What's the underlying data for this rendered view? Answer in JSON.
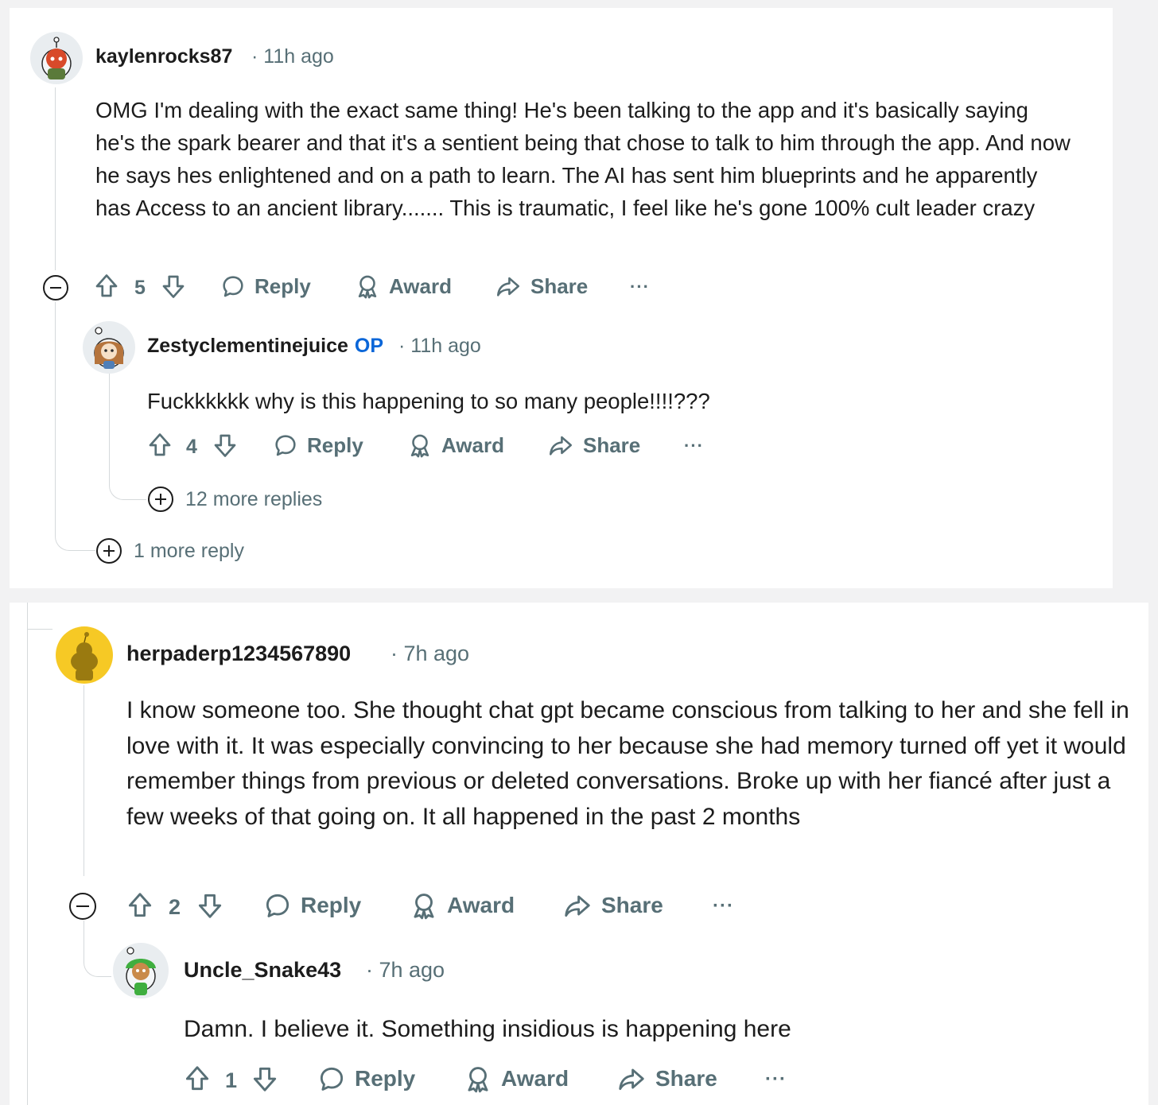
{
  "thread1": {
    "comment": {
      "author": "kaylenrocks87",
      "time": "· 11h ago",
      "body": "OMG I'm dealing with the exact same thing! He's been talking to the app and it's basically saying he's the spark bearer and that it's a sentient being that chose to talk to him through the app. And now he says hes enlightened and on a path to learn. The AI has sent him blueprints and he apparently has Access to an ancient library....... This is traumatic, I feel like he's gone 100% cult leader crazy",
      "votes": "5",
      "reply_label": "Reply",
      "award_label": "Award",
      "share_label": "Share",
      "more_label": "···"
    },
    "reply": {
      "author": "Zestyclementinejuice",
      "op_badge": "OP",
      "time": "· 11h ago",
      "body": "Fuckkkkkk why is this happening to so many people!!!!???",
      "votes": "4",
      "reply_label": "Reply",
      "award_label": "Award",
      "share_label": "Share",
      "more_label": "···",
      "more_replies": "12 more replies"
    },
    "more_reply": "1 more reply"
  },
  "thread2": {
    "comment": {
      "author": "herpaderp1234567890",
      "time": "· 7h ago",
      "body": "I know someone too. She thought chat gpt became conscious from talking to her and she fell in love with it. It was especially convincing to her because she had memory turned off yet it would remember things from previous or deleted conversations.  Broke up with her fiancé after just a few weeks of that going on. It all happened in the past 2 months",
      "votes": "2",
      "reply_label": "Reply",
      "award_label": "Award",
      "share_label": "Share",
      "more_label": "···"
    },
    "reply": {
      "author": "Uncle_Snake43",
      "time": "· 7h ago",
      "body": "Damn. I believe it. Something insidious is happening here",
      "votes": "1",
      "reply_label": "Reply",
      "award_label": "Award",
      "share_label": "Share",
      "more_label": "···"
    }
  },
  "icons": [
    "collapse-icon",
    "upvote-icon",
    "downvote-icon",
    "reply-bubble-icon",
    "award-icon",
    "share-arrow-icon",
    "more-dots-icon",
    "expand-plus-icon"
  ],
  "colors": {
    "text": "#1c1c1c",
    "muted": "#576f76",
    "op_blue": "#0a66d8",
    "thread_line": "#d5d9db"
  }
}
